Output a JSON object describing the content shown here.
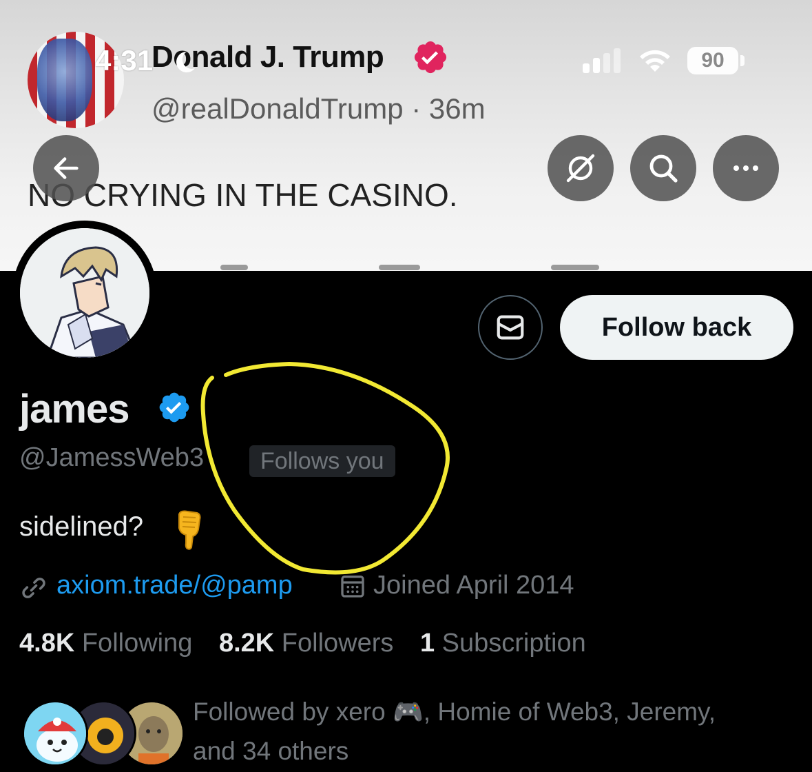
{
  "status_bar": {
    "time": "4:31",
    "battery": "90"
  },
  "banner": {
    "post_author_name": "Donald J. Trump",
    "post_author_handle": "@realDonaldTrump · 36m",
    "post_text": "NO CRYING IN THE CASINO."
  },
  "header_buttons": {
    "back_icon": "back-arrow-icon",
    "grok_icon": "grok-icon",
    "search_icon": "search-icon",
    "more_icon": "more-icon"
  },
  "profile": {
    "display_name": "james",
    "handle": "@JamessWeb3",
    "follows_you": "Follows you",
    "bio": "sidelined?",
    "bio_emoji": "👇",
    "link": "axiom.trade/@pamp",
    "joined": "Joined April 2014",
    "follow_button": "Follow back",
    "message_icon": "message-icon"
  },
  "stats": {
    "following_count": "4.8K",
    "following_label": "Following",
    "followers_count": "8.2K",
    "followers_label": "Followers",
    "subscription_count": "1",
    "subscription_label": "Subscription"
  },
  "followed_by": {
    "prefix": "Followed by xero",
    "game_emoji": "🎮",
    "rest_line1": ", Homie of Web3, Jeremy,",
    "line2": "and 34 others"
  },
  "colors": {
    "background": "#000000",
    "link": "#1d9bf0",
    "verified": "#1d9bf0",
    "secondary_text": "#71767b",
    "annotation": "#f2e933"
  }
}
